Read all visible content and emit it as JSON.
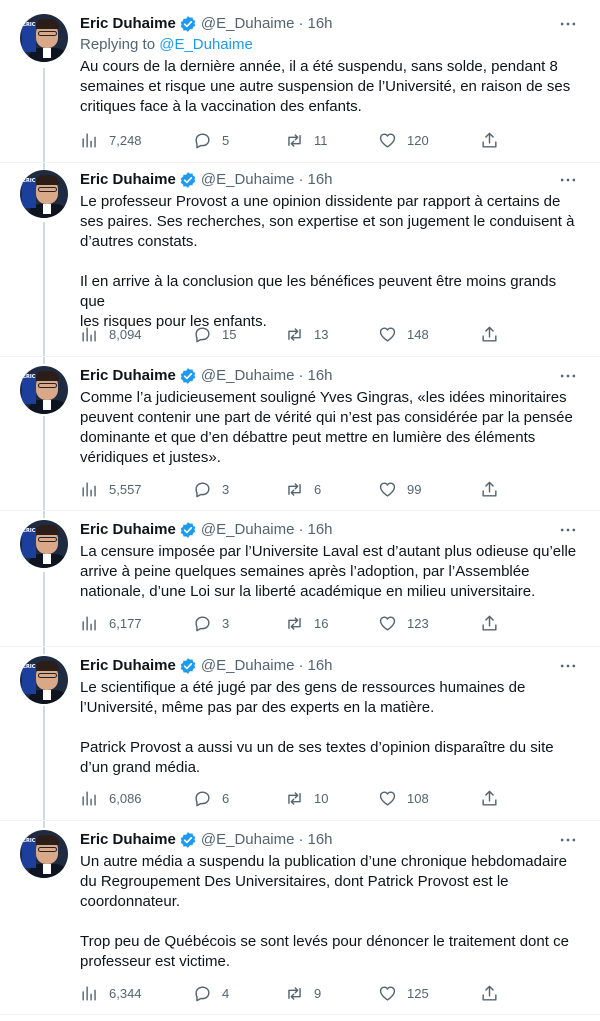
{
  "author": {
    "name": "Eric Duhaime",
    "handle": "@E_Duhaime",
    "dot": "·",
    "time": "16h",
    "avatar_brand": "ERIC"
  },
  "tweets": [
    {
      "replying_prefix": "Replying to",
      "replying_handle": "@E_Duhaime",
      "text": "Au cours de la dernière année, il a été suspendu, sans solde, pendant 8\nsemaines et risque une autre suspension de l’Université, en raison de ses\ncritiques face à la vaccination des enfants.",
      "views": "7,248",
      "replies": "5",
      "retweets": "11",
      "likes": "120"
    },
    {
      "text": "Le professeur Provost a une opinion dissidente par rapport à certains de\nses paires. Ses recherches, son expertise et son jugement le conduisent à\nd’autres constats.\n\nIl en arrive à la conclusion que les bénéfices peuvent être moins grands que\nles risques pour les enfants.",
      "views": "8,094",
      "replies": "15",
      "retweets": "13",
      "likes": "148"
    },
    {
      "text": "Comme l’a judicieusement souligné Yves Gingras, «les idées minoritaires\npeuvent contenir une part de vérité qui n’est pas considérée par la pensée\ndominante et que d’en débattre peut mettre en lumière des éléments\nvéridiques et justes».",
      "views": "5,557",
      "replies": "3",
      "retweets": "6",
      "likes": "99"
    },
    {
      "text": "La censure imposée par l’Universite Laval est d’autant plus odieuse qu’elle\narrive à peine quelques semaines après l’adoption, par l’Assemblée\nnationale, d’une Loi sur la liberté académique en milieu universitaire.",
      "views": "6,177",
      "replies": "3",
      "retweets": "16",
      "likes": "123"
    },
    {
      "text": "Le scientifique a été jugé par des gens de ressources humaines de\nl’Université, même pas par des experts en la matière.\n\nPatrick Provost a aussi vu un de ses textes d’opinion disparaître du site\nd’un grand média.",
      "views": "6,086",
      "replies": "6",
      "retweets": "10",
      "likes": "108"
    },
    {
      "text": "Un autre média a suspendu la publication d’une chronique hebdomadaire\ndu Regroupement Des Universitaires, dont Patrick Provost est le\ncoordonnateur.\n\nTrop peu de Québécois se sont levés pour dénoncer le traitement dont ce\nprofesseur est victime.",
      "views": "6,344",
      "replies": "4",
      "retweets": "9",
      "likes": "125"
    }
  ],
  "colors": {
    "text": "#0f1419",
    "muted": "#536471",
    "link": "#1d9bf0",
    "thread_line": "#cfd9de",
    "verified": "#1d9bf0"
  },
  "icons": [
    "verified-badge-icon",
    "more-icon",
    "views-icon",
    "reply-icon",
    "retweet-icon",
    "like-icon",
    "share-icon"
  ]
}
